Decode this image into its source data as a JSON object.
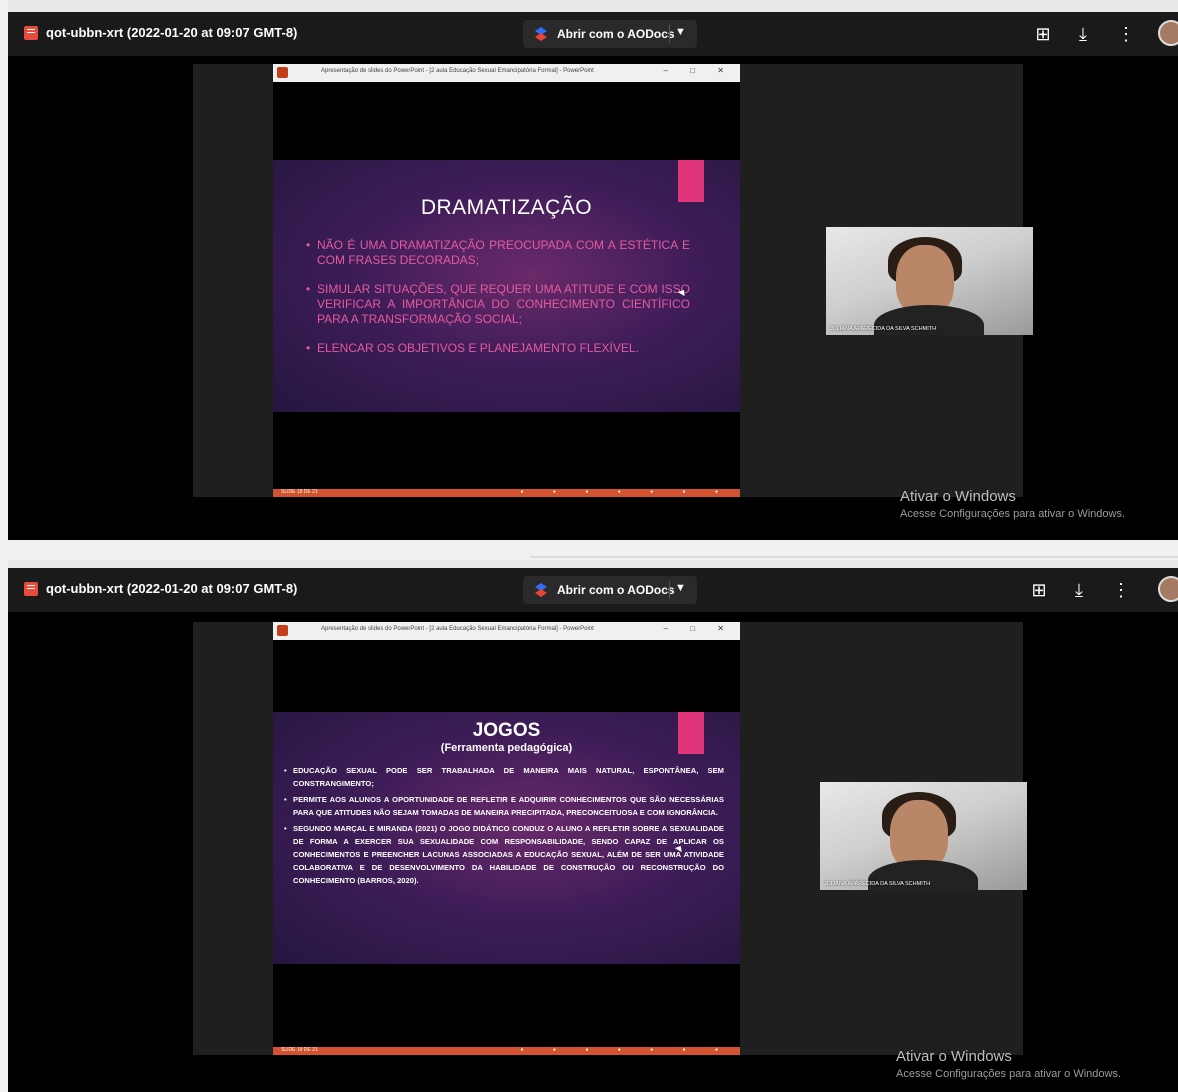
{
  "panels": [
    {
      "header": {
        "filename": "qot-ubbn-xrt (2022-01-20 at 09:07 GMT-8)",
        "open_with_label": "Abrir com o AODocs",
        "icons": [
          "add-comment-icon",
          "download-icon",
          "more-vert-icon",
          "avatar"
        ]
      },
      "powerpoint": {
        "window_title": "Apresentação de slides do PowerPoint - [2 aula Educação Sexual Emancipatória Formal] - PowerPoint",
        "window_controls": "– □ ✕",
        "status_left": "SLIDE 18 DE 21"
      },
      "slide": {
        "title": "DRAMATIZAÇÃO",
        "bullets": [
          "NÃO É UMA DRAMATIZAÇÃO PREOCUPADA COM A ESTÉTICA E COM FRASES DECORADAS;",
          "SIMULAR SITUAÇÕES, QUE REQUER UMA ATITUDE E COM ISSO VERIFICAR A IMPORTÂNCIA DO CONHECIMENTO CIENTÍFICO PARA A TRANSFORMAÇÃO SOCIAL;",
          "ELENCAR OS OBJETIVOS E PLANEJAMENTO FLEXÍVEL."
        ]
      },
      "participant": {
        "name": "JULIANA APARECIDA DA SILVA SCHMITH"
      },
      "watermark": {
        "line1": "Ativar o Windows",
        "line2": "Acesse Configurações para ativar o Windows."
      }
    },
    {
      "header": {
        "filename": "qot-ubbn-xrt (2022-01-20 at 09:07 GMT-8)",
        "open_with_label": "Abrir com o AODocs",
        "icons": [
          "add-comment-icon",
          "download-icon",
          "more-vert-icon",
          "avatar"
        ]
      },
      "powerpoint": {
        "window_title": "Apresentação de slides do PowerPoint - [2 aula Educação Sexual Emancipatória Formal] - PowerPoint",
        "window_controls": "– □ ✕",
        "status_left": "SLIDE 19 DE 21"
      },
      "slide": {
        "title": "JOGOS",
        "subtitle": "(Ferramenta pedagógica)",
        "bullets": [
          "EDUCAÇÃO SEXUAL PODE SER TRABALHADA DE MANEIRA MAIS NATURAL, ESPONTÂNEA, SEM CONSTRANGIMENTO;",
          "PERMITE AOS ALUNOS A OPORTUNIDADE DE REFLETIR E ADQUIRIR CONHECIMENTOS QUE SÃO NECESSÁRIAS PARA QUE ATITUDES NÃO SEJAM TOMADAS DE MANEIRA PRECIPITADA, PRECONCEITUOSA E COM IGNORÂNCIA.",
          "SEGUNDO MARÇAL E MIRANDA (2021) O JOGO DIDÁTICO CONDUZ O ALUNO A REFLETIR SOBRE A SEXUALIDADE DE FORMA A EXERCER SUA SEXUALIDADE COM RESPONSABILIDADE, SENDO CAPAZ DE APLICAR OS CONHECIMENTOS E PREENCHER LACUNAS ASSOCIADAS A EDUCAÇÃO SEXUAL, ALÉM DE SER UMA ATIVIDADE COLABORATIVA E DE DESENVOLVIMENTO DA HABILIDADE DE CONSTRUÇÃO OU RECONSTRUÇÃO DO CONHECIMENTO (BARROS, 2020)."
        ]
      },
      "participant": {
        "name": "JULIANA APARECIDA DA SILVA SCHMITH"
      },
      "watermark": {
        "line1": "Ativar o Windows",
        "line2": "Acesse Configurações para ativar o Windows."
      }
    }
  ],
  "colors": {
    "header_bg": "#1a1a1a",
    "slide_pink_accent": "#e0357a",
    "bullet_pink": "#e55aa0",
    "ppt_status_orange": "#d35230"
  }
}
